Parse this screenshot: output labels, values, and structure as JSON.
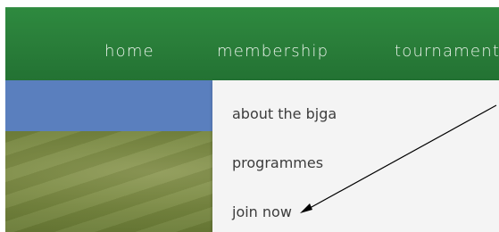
{
  "nav": {
    "items": [
      {
        "label": "home"
      },
      {
        "label": "membership"
      },
      {
        "label": "tournaments"
      }
    ]
  },
  "dropdown": {
    "items": [
      {
        "label": "about the bjga"
      },
      {
        "label": "programmes"
      },
      {
        "label": "join now"
      }
    ]
  },
  "colors": {
    "nav_green": "#2a7f3a",
    "band_blue": "#5a7fbe",
    "dropdown_bg": "#f4f4f4",
    "arrow": "#000000"
  },
  "annotations": {
    "arrow": "pointer-arrow-icon"
  }
}
